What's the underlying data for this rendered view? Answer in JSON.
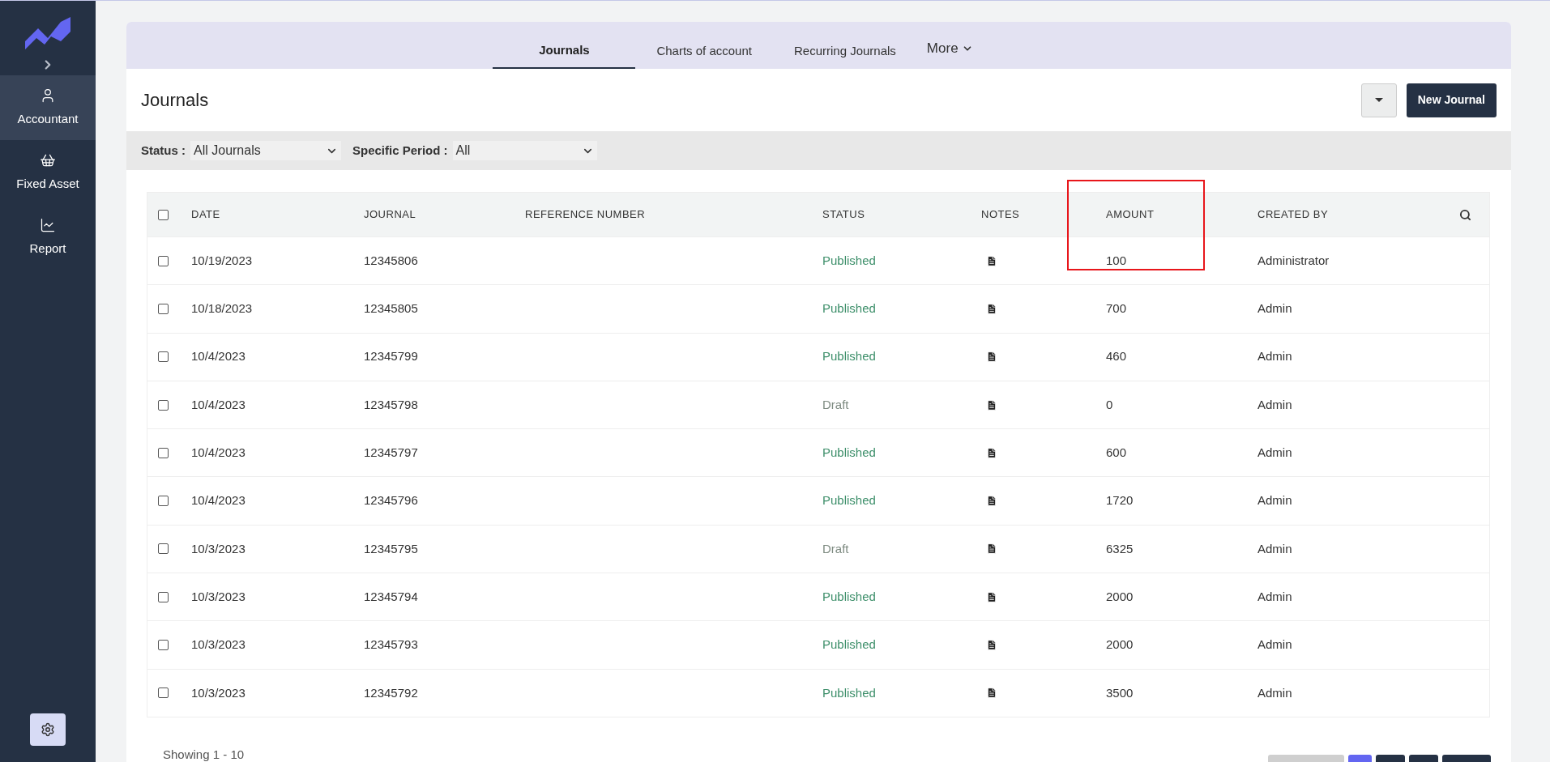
{
  "sidebar": {
    "items": [
      {
        "label": "Accountant",
        "selected": true
      },
      {
        "label": "Fixed Asset",
        "selected": false
      },
      {
        "label": "Report",
        "selected": false
      }
    ]
  },
  "tabs": [
    {
      "label": "Journals",
      "selected": true
    },
    {
      "label": "Charts of account",
      "selected": false
    },
    {
      "label": "Recurring Journals",
      "selected": false
    }
  ],
  "more_tab": {
    "label": "More"
  },
  "page_title": "Journals",
  "new_button": "New Journal",
  "filters": [
    {
      "label": "Status :",
      "value": "All Journals"
    },
    {
      "label": "Specific Period :",
      "value": "All"
    }
  ],
  "table": {
    "all_checked": false,
    "columns": [
      {
        "label": "DATE",
        "highlighted": false
      },
      {
        "label": "JOURNAL",
        "highlighted": false
      },
      {
        "label": "REFERENCE NUMBER",
        "highlighted": false
      },
      {
        "label": "STATUS",
        "highlighted": false
      },
      {
        "label": "NOTES",
        "highlighted": false
      },
      {
        "label": "AMOUNT",
        "highlighted": true
      },
      {
        "label": "CREATED BY",
        "highlighted": false
      }
    ],
    "rows": [
      {
        "checked": false,
        "date": "10/19/2023",
        "journal": "12345806",
        "status": "Published",
        "kind": "published",
        "amount": "100",
        "created_by": "Administrator"
      },
      {
        "checked": false,
        "date": "10/18/2023",
        "journal": "12345805",
        "status": "Published",
        "kind": "published",
        "amount": "700",
        "created_by": "Admin"
      },
      {
        "checked": false,
        "date": "10/4/2023",
        "journal": "12345799",
        "status": "Published",
        "kind": "published",
        "amount": "460",
        "created_by": "Admin"
      },
      {
        "checked": false,
        "date": "10/4/2023",
        "journal": "12345798",
        "status": "Draft",
        "kind": "draft",
        "amount": "0",
        "created_by": "Admin"
      },
      {
        "checked": false,
        "date": "10/4/2023",
        "journal": "12345797",
        "status": "Published",
        "kind": "published",
        "amount": "600",
        "created_by": "Admin"
      },
      {
        "checked": false,
        "date": "10/4/2023",
        "journal": "12345796",
        "status": "Published",
        "kind": "published",
        "amount": "1720",
        "created_by": "Admin"
      },
      {
        "checked": false,
        "date": "10/3/2023",
        "journal": "12345795",
        "status": "Draft",
        "kind": "draft",
        "amount": "6325",
        "created_by": "Admin"
      },
      {
        "checked": false,
        "date": "10/3/2023",
        "journal": "12345794",
        "status": "Published",
        "kind": "published",
        "amount": "2000",
        "created_by": "Admin"
      },
      {
        "checked": false,
        "date": "10/3/2023",
        "journal": "12345793",
        "status": "Published",
        "kind": "published",
        "amount": "2000",
        "created_by": "Admin"
      },
      {
        "checked": false,
        "date": "10/3/2023",
        "journal": "12345792",
        "status": "Published",
        "kind": "published",
        "amount": "3500",
        "created_by": "Admin"
      }
    ]
  },
  "footer": {
    "showing": "Showing 1 - 10"
  }
}
